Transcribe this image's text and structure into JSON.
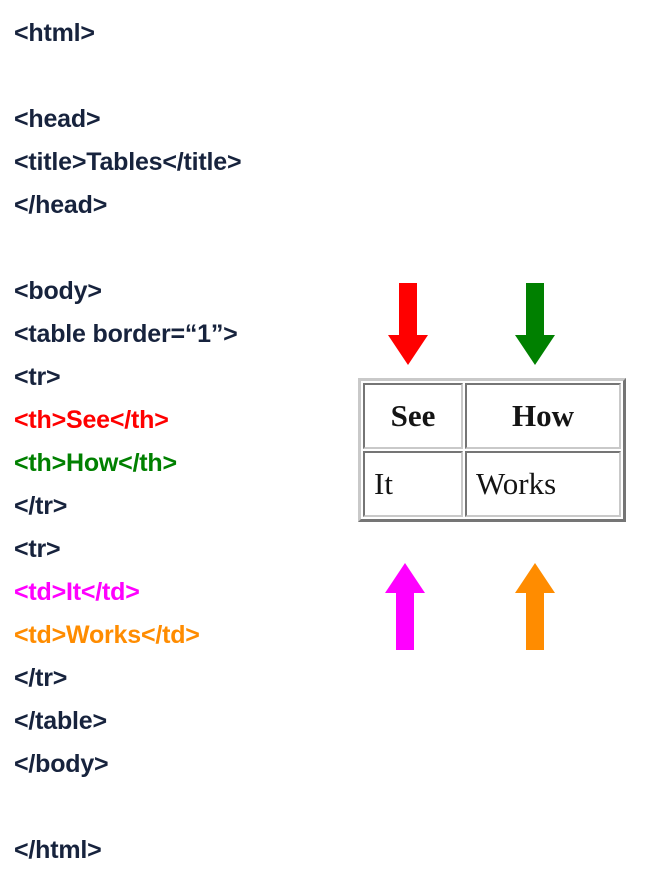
{
  "colors": {
    "code_default": "#17233d",
    "see_red": "#FF0000",
    "how_green": "#008000",
    "it_magenta": "#FF00FF",
    "works_orange": "#FF8C00",
    "table_bevel": "#C9C9C9",
    "table_text": "#141414",
    "page_background": "#FFFFFF"
  },
  "code": {
    "lines": [
      {
        "text": "<html>",
        "color": "#17233d"
      },
      {
        "text": "",
        "color": "#17233d"
      },
      {
        "text": "<head>",
        "color": "#17233d"
      },
      {
        "text": "<title>Tables</title>",
        "color": "#17233d"
      },
      {
        "text": "</head>",
        "color": "#17233d"
      },
      {
        "text": "",
        "color": "#17233d"
      },
      {
        "text": "<body>",
        "color": "#17233d"
      },
      {
        "text": "<table border=“1”>",
        "color": "#17233d"
      },
      {
        "text": "<tr>",
        "color": "#17233d"
      },
      {
        "text": "<th>See</th>",
        "color": "#FF0000"
      },
      {
        "text": "<th>How</th>",
        "color": "#008000"
      },
      {
        "text": "</tr>",
        "color": "#17233d"
      },
      {
        "text": "<tr>",
        "color": "#17233d"
      },
      {
        "text": "<td>It</td>",
        "color": "#FF00FF"
      },
      {
        "text": "<td>Works</td>",
        "color": "#FF8C00"
      },
      {
        "text": "</tr>",
        "color": "#17233d"
      },
      {
        "text": "</table>",
        "color": "#17233d"
      },
      {
        "text": "</body>",
        "color": "#17233d"
      },
      {
        "text": "",
        "color": "#17233d"
      },
      {
        "text": "</html>",
        "color": "#17233d"
      }
    ]
  },
  "rendered_table": {
    "border": "1",
    "rows": [
      {
        "type": "header",
        "cells": [
          {
            "text": "See"
          },
          {
            "text": "How"
          }
        ]
      },
      {
        "type": "data",
        "cells": [
          {
            "text": "It"
          },
          {
            "text": "Works"
          }
        ]
      }
    ]
  },
  "arrows": [
    {
      "id": "arrow-see",
      "icon": "arrow-down-icon",
      "direction": "down",
      "color": "#FF0000",
      "points_to": "See"
    },
    {
      "id": "arrow-how",
      "icon": "arrow-down-icon",
      "direction": "down",
      "color": "#008000",
      "points_to": "How"
    },
    {
      "id": "arrow-it",
      "icon": "arrow-up-icon",
      "direction": "up",
      "color": "#FF00FF",
      "points_to": "It"
    },
    {
      "id": "arrow-works",
      "icon": "arrow-up-icon",
      "direction": "up",
      "color": "#FF8C00",
      "points_to": "Works"
    }
  ]
}
